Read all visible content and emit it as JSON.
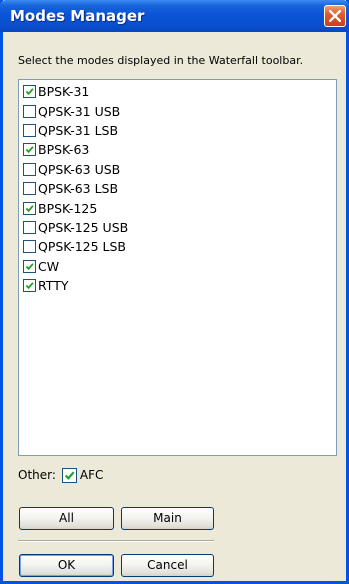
{
  "window": {
    "title": "Modes Manager",
    "close_icon": "close-x-icon"
  },
  "instruction": "Select the modes displayed in the Waterfall toolbar.",
  "modes": [
    {
      "label": "BPSK-31",
      "checked": true
    },
    {
      "label": "QPSK-31 USB",
      "checked": false
    },
    {
      "label": "QPSK-31 LSB",
      "checked": false
    },
    {
      "label": "BPSK-63",
      "checked": true
    },
    {
      "label": "QPSK-63 USB",
      "checked": false
    },
    {
      "label": "QPSK-63 LSB",
      "checked": false
    },
    {
      "label": "BPSK-125",
      "checked": true
    },
    {
      "label": "QPSK-125 USB",
      "checked": false
    },
    {
      "label": "QPSK-125 LSB",
      "checked": false
    },
    {
      "label": "CW",
      "checked": true
    },
    {
      "label": "RTTY",
      "checked": true
    }
  ],
  "other": {
    "label": "Other:",
    "afc_label": "AFC",
    "afc_checked": true
  },
  "buttons": {
    "all": "All",
    "main": "Main",
    "ok": "OK",
    "cancel": "Cancel"
  },
  "colors": {
    "title_bar": "#0a55d6",
    "dialog_bg": "#ece9d8",
    "check": "#21a121"
  }
}
